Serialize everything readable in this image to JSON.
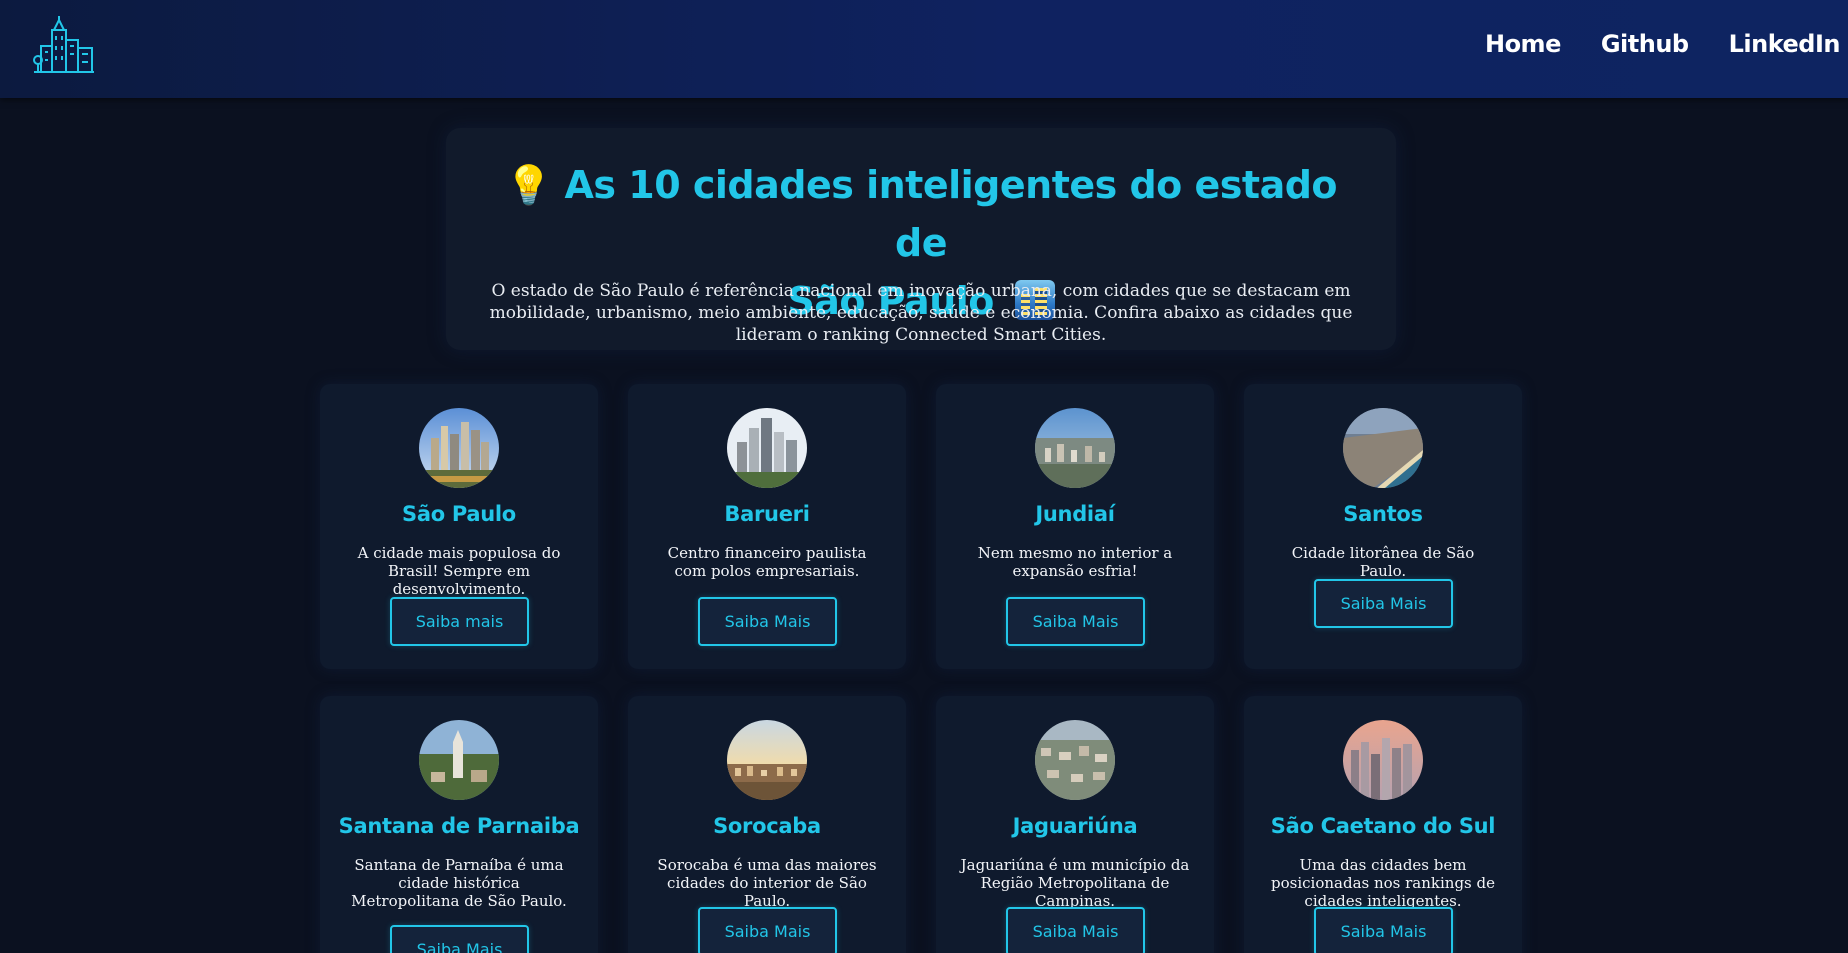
{
  "nav": {
    "logo_icon": "city-buildings-icon",
    "links": [
      {
        "label": "Home"
      },
      {
        "label": "Github"
      },
      {
        "label": "LinkedIn"
      }
    ]
  },
  "hero": {
    "emoji_bulb": "💡",
    "title": "As 10 cidades inteligentes do estado de São Paulo",
    "title_line1": "As 10 cidades inteligentes do estado de",
    "title_line2": "São Paulo",
    "description": "O estado de São Paulo é referência nacional em inovação urbana, com cidades que se destacam em mobilidade, urbanismo, meio ambiente, educação, saúde e economia. Confira abaixo as cidades que lideram o ranking Connected Smart Cities."
  },
  "cities": [
    {
      "name": "São Paulo",
      "description": "A cidade mais populosa do Brasil! Sempre em desenvolvimento.",
      "button": "Saiba mais"
    },
    {
      "name": "Barueri",
      "description": "Centro financeiro paulista com polos empresariais.",
      "button": "Saiba Mais"
    },
    {
      "name": "Jundiaí",
      "description": "Nem mesmo no interior a expansão esfria!",
      "button": "Saiba Mais"
    },
    {
      "name": "Santos",
      "description": "Cidade litorânea de São Paulo.",
      "button": "Saiba Mais"
    },
    {
      "name": "Santana de Parnaiba",
      "description": "Santana de Parnaíba é uma cidade histórica Metropolitana de São Paulo.",
      "button": "Saiba Mais"
    },
    {
      "name": "Sorocaba",
      "description": "Sorocaba é uma das maiores cidades do interior de São Paulo.",
      "button": "Saiba Mais"
    },
    {
      "name": "Jaguariúna",
      "description": "Jaguariúna é um município da Região Metropolitana de Campinas.",
      "button": "Saiba Mais"
    },
    {
      "name": "São Caetano do Sul",
      "description": "Uma das cidades bem posicionadas nos rankings de cidades inteligentes.",
      "button": "Saiba Mais"
    }
  ],
  "colors": {
    "accent": "#22c6e8",
    "background": "#0b1120",
    "card": "#0f1a2d",
    "nav": "#0f2260"
  }
}
